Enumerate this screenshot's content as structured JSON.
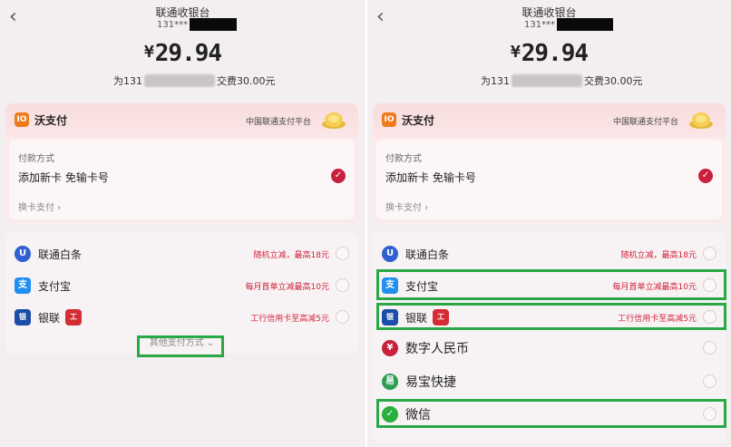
{
  "header": {
    "title": "联通收银台",
    "phone_prefix": "131***"
  },
  "amount": {
    "currency": "¥",
    "value": "29.94"
  },
  "fee": {
    "prefix": "为131",
    "suffix": "交费30.00元"
  },
  "wopay": {
    "name": "沃支付",
    "platform": "中国联通支付平台",
    "method_label": "付款方式",
    "method_value": "添加新卡 免输卡号",
    "switch_label": "换卡支付 ›"
  },
  "options": [
    {
      "name": "联通白条",
      "promo": "随机立减，最高18元",
      "icon": "unicom-baitiao-icon",
      "color": "#2f5fd0"
    },
    {
      "name": "支付宝",
      "promo": "每月首单立减最高10元",
      "icon": "alipay-icon",
      "color": "#1f8ff0"
    },
    {
      "name": "银联",
      "promo": "工行信用卡至高减5元",
      "icon": "unionpay-icon",
      "color": "#1b4ea8"
    }
  ],
  "more_label": "其他支付方式",
  "extra_options": [
    {
      "name": "数字人民币",
      "icon": "digital-rmb-icon",
      "color": "#c8213e"
    },
    {
      "name": "易宝快捷",
      "icon": "yeepay-icon",
      "color": "#2e9e55"
    },
    {
      "name": "微信",
      "icon": "wechat-icon",
      "color": "#2aae3c"
    }
  ],
  "colors": {
    "accent": "#c8213e",
    "highlight": "#2aa845",
    "promo": "#d0213a"
  }
}
